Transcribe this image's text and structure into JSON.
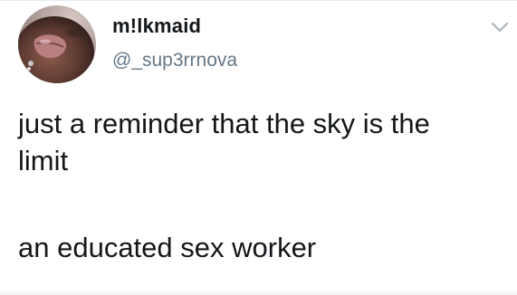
{
  "tweet": {
    "author": {
      "display_name": "m!lkmaid",
      "handle": "@_sup3rrnova",
      "avatar_icon": "profile-photo"
    },
    "text_lines": [
      "just a reminder that the sky is the",
      "limit",
      "an educated sex worker"
    ],
    "menu_icon": "chevron-down-icon"
  },
  "colors": {
    "text_primary": "#14171a",
    "text_secondary": "#657786",
    "caret": "#aab8c2",
    "background": "#ffffff"
  }
}
